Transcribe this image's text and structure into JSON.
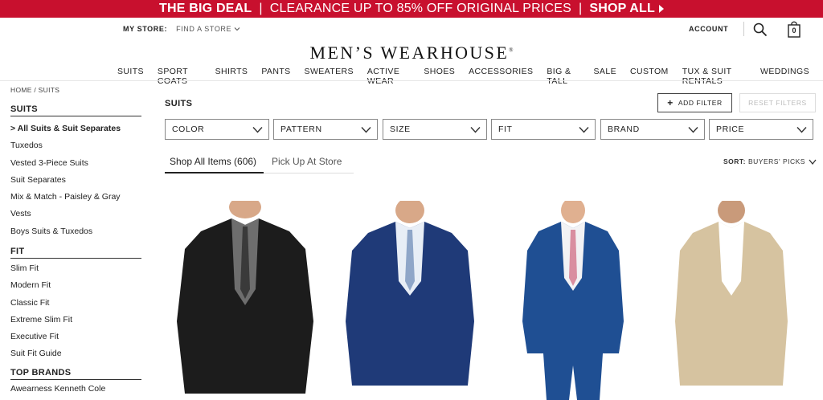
{
  "promo": {
    "deal": "THE BIG DEAL",
    "sep1": "|",
    "text": "CLEARANCE UP TO 85% OFF ORIGINAL PRICES",
    "sep2": "|",
    "cta": "SHOP ALL"
  },
  "utility": {
    "my_store_label": "MY STORE:",
    "find_store": "FIND A STORE",
    "account": "ACCOUNT",
    "bag_count": "0"
  },
  "logo": {
    "text": "MEN’S WEARHOUSE",
    "mark": "®"
  },
  "nav": [
    "SUITS",
    "SPORT COATS",
    "SHIRTS",
    "PANTS",
    "SWEATERS",
    "ACTIVE WEAR",
    "SHOES",
    "ACCESSORIES",
    "BIG & TALL",
    "SALE",
    "CUSTOM",
    "TUX & SUIT RENTALS",
    "WEDDINGS"
  ],
  "breadcrumb": "HOME / SUITS",
  "sidebar": {
    "sections": [
      {
        "heading": "SUITS",
        "items": [
          "> All Suits & Suit Separates",
          "Tuxedos",
          "Vested 3-Piece Suits",
          "Suit Separates",
          "Mix & Match - Paisley & Gray",
          "Vests",
          "Boys Suits & Tuxedos"
        ]
      },
      {
        "heading": "FIT",
        "items": [
          "Slim Fit",
          "Modern Fit",
          "Classic Fit",
          "Extreme Slim Fit",
          "Executive Fit",
          "Suit Fit Guide"
        ]
      },
      {
        "heading": "TOP BRANDS",
        "items": [
          "Awearness Kenneth Cole"
        ]
      }
    ]
  },
  "page_title": "SUITS",
  "buttons": {
    "add_filter": "ADD FILTER",
    "add_icon": "+",
    "reset_filters": "RESET FILTERS"
  },
  "filters": [
    "COLOR",
    "PATTERN",
    "SIZE",
    "FIT",
    "BRAND",
    "PRICE"
  ],
  "tabs": {
    "all": "Shop All Items (606)",
    "pickup": "Pick Up At Store"
  },
  "sort": {
    "label": "SORT:",
    "value": "BUYERS' PICKS"
  },
  "products": [
    {
      "suit_color": "#1c1c1c",
      "shirt_color": "#6e6e6e",
      "tie_color": "#3a3a3a"
    },
    {
      "suit_color": "#1f3a78",
      "shirt_color": "#e8eef6",
      "tie_color": "#8fa6c8"
    },
    {
      "suit_color": "#1f4f93",
      "shirt_color": "#f2f2f4",
      "tie_color": "#d98ea0"
    },
    {
      "suit_color": "#d6c3a0",
      "shirt_color": "#ffffff",
      "tie_color": "#ffffff"
    }
  ],
  "colors": {
    "promo_bg": "#c8102e",
    "text": "#222222"
  }
}
